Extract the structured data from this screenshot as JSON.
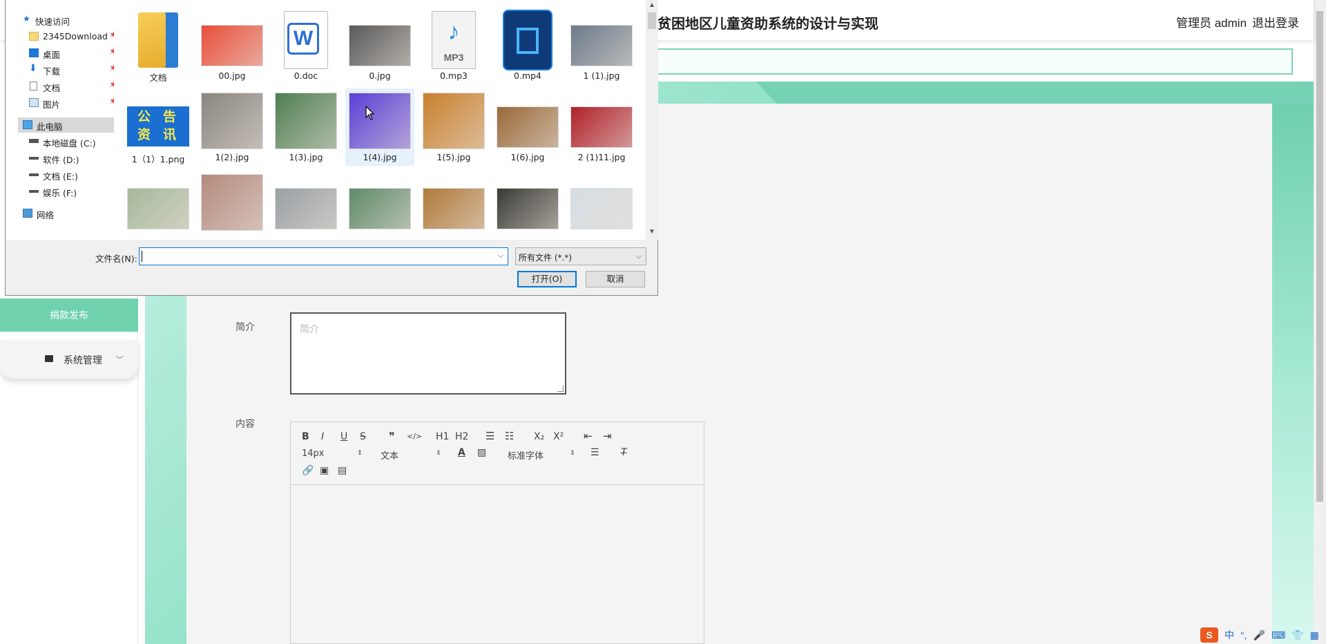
{
  "app": {
    "title": "贫困地区儿童资助系统的设计与实现",
    "user": "管理员 admin",
    "logout": "退出登录"
  },
  "sidebar": {
    "donate": "捐款发布",
    "system": "系统管理"
  },
  "form": {
    "intro_label": "简介",
    "intro_placeholder": "简介",
    "content_label": "内容"
  },
  "editor": {
    "font_size": "14px",
    "header_select": "文本",
    "font_family": "标准字体",
    "buttons": [
      "B",
      "I",
      "U",
      "S",
      "❞",
      "</>",
      "H1",
      "H2",
      "ordered-list",
      "bullet-list",
      "X₂",
      "X²",
      "outdent",
      "indent"
    ]
  },
  "dialog": {
    "nav": [
      {
        "label": "快速访问",
        "icon": "star-icon"
      },
      {
        "label": "2345Download",
        "icon": "folder-icon",
        "pinned": true
      },
      {
        "label": "桌面",
        "icon": "desktop-icon",
        "pinned": true
      },
      {
        "label": "下载",
        "icon": "download-icon",
        "pinned": true
      },
      {
        "label": "文档",
        "icon": "document-icon",
        "pinned": true
      },
      {
        "label": "图片",
        "icon": "picture-icon",
        "pinned": true
      },
      {
        "label": "此电脑",
        "icon": "computer-icon",
        "selected": true
      },
      {
        "label": "本地磁盘 (C:)",
        "icon": "drive-icon"
      },
      {
        "label": "软件 (D:)",
        "icon": "drive-icon"
      },
      {
        "label": "文档 (E:)",
        "icon": "drive-icon"
      },
      {
        "label": "娱乐 (F:)",
        "icon": "drive-icon"
      },
      {
        "label": "网络",
        "icon": "network-icon"
      }
    ],
    "files": [
      {
        "name": "文档",
        "kind": "folder"
      },
      {
        "name": "00.jpg",
        "kind": "image",
        "color": "#e94e3a"
      },
      {
        "name": "0.doc",
        "kind": "doc"
      },
      {
        "name": "0.jpg",
        "kind": "image",
        "color": "#5a5a5a"
      },
      {
        "name": "0.mp3",
        "kind": "mp3"
      },
      {
        "name": "0.mp4",
        "kind": "mp4"
      },
      {
        "name": "1 (1).jpg",
        "kind": "image",
        "color": "#6c7a8a"
      },
      {
        "name": "1（1）1.png",
        "kind": "notice"
      },
      {
        "name": "1(2).jpg",
        "kind": "image",
        "color": "#8a8580"
      },
      {
        "name": "1(3).jpg",
        "kind": "image",
        "color": "#4f7f52"
      },
      {
        "name": "1(4).jpg",
        "kind": "image",
        "color": "#5a3fd6",
        "selected": true
      },
      {
        "name": "1(5).jpg",
        "kind": "image",
        "color": "#c9802e"
      },
      {
        "name": "1(6).jpg",
        "kind": "image",
        "color": "#9a6a3a"
      },
      {
        "name": "2 (1)11.jpg",
        "kind": "image",
        "color": "#b0202a"
      },
      {
        "name": "",
        "kind": "image",
        "color": "#a6b89a"
      },
      {
        "name": "",
        "kind": "image",
        "color": "#b58b7e"
      },
      {
        "name": "",
        "kind": "image",
        "color": "#9aa0a4"
      },
      {
        "name": "",
        "kind": "image",
        "color": "#5f8a6a"
      },
      {
        "name": "",
        "kind": "image",
        "color": "#b07a3a"
      },
      {
        "name": "",
        "kind": "image",
        "color": "#3a3a36"
      },
      {
        "name": "",
        "kind": "image",
        "color": "#d6dde4"
      }
    ],
    "filename_label": "文件名(N):",
    "filename_value": "",
    "filetype": "所有文件 (*.*)",
    "open": "打开(O)",
    "cancel": "取消"
  },
  "ime": {
    "lang": "中"
  }
}
